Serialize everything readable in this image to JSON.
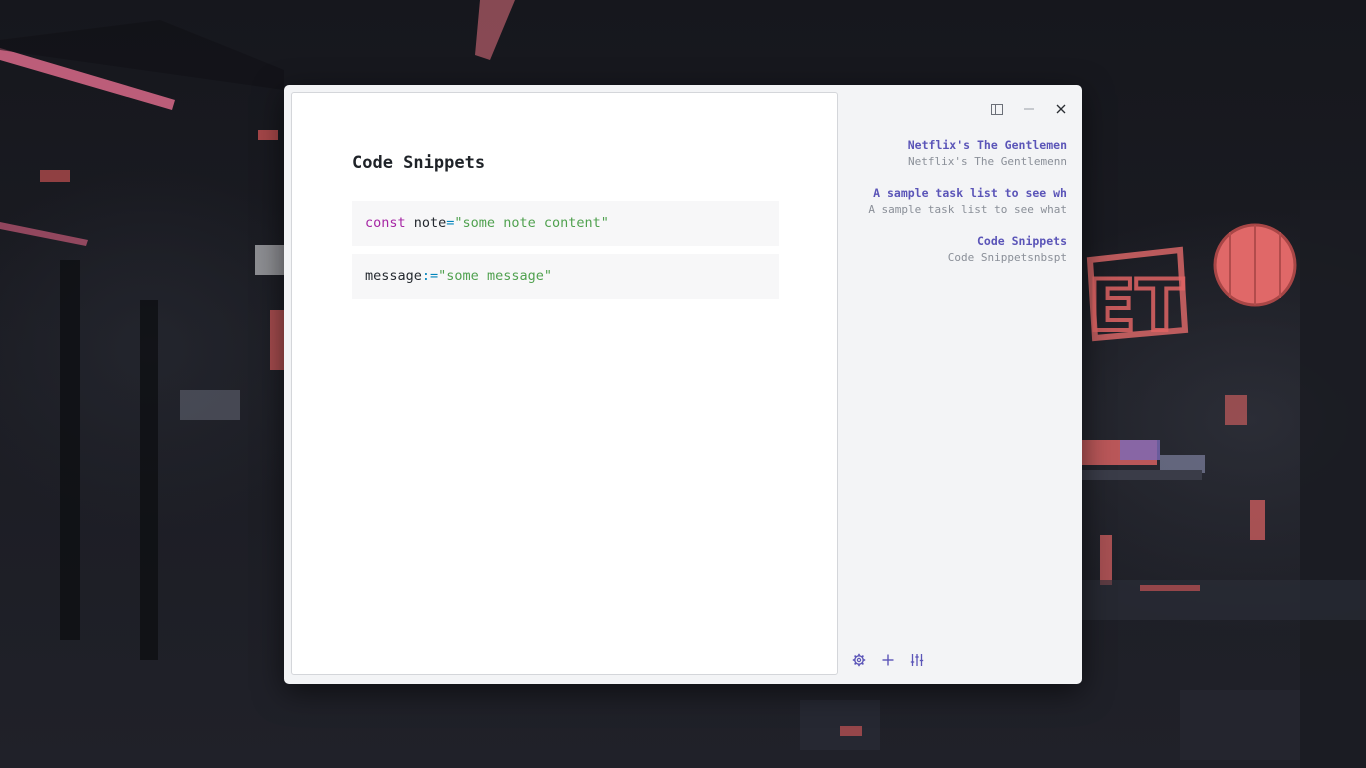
{
  "editor": {
    "title": "Code Snippets",
    "code_blocks": [
      {
        "tokens": [
          {
            "kind": "keyword",
            "text": "const"
          },
          {
            "kind": "ident",
            "text": " note"
          },
          {
            "kind": "op",
            "text": "="
          },
          {
            "kind": "string",
            "text": "\"some note content\""
          }
        ]
      },
      {
        "tokens": [
          {
            "kind": "ident",
            "text": "message"
          },
          {
            "kind": "op",
            "text": ":="
          },
          {
            "kind": "string",
            "text": "\"some message\""
          }
        ]
      }
    ]
  },
  "window_controls": {
    "icons": [
      "sidebar-toggle-icon",
      "minimize-icon",
      "close-icon"
    ]
  },
  "sidebar": {
    "notes": [
      {
        "title": "Netflix's The Gentlemen",
        "preview": "Netflix's The Gentlemenn"
      },
      {
        "title": "A sample task list to see wh",
        "preview": "A sample task list to see what"
      },
      {
        "title": "Code Snippets",
        "preview": "Code Snippetsnbspt"
      }
    ],
    "footer_icons": [
      "settings-gear-icon",
      "add-note-plus-icon",
      "sliders-icon"
    ]
  },
  "colors": {
    "accent": "#5b55b8",
    "preview_text": "#8a8f98",
    "keyword": "#a626a4",
    "operator": "#0184bc",
    "string": "#50a14f",
    "code_background": "#f7f7f8",
    "sidebar_background": "#f3f4f6"
  }
}
